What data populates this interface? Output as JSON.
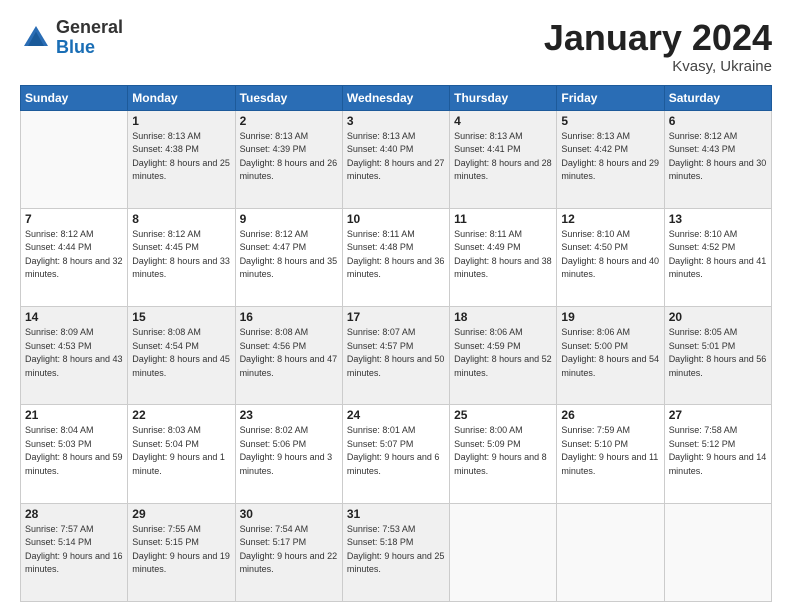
{
  "logo": {
    "general": "General",
    "blue": "Blue"
  },
  "header": {
    "month": "January 2024",
    "location": "Kvasy, Ukraine"
  },
  "days_of_week": [
    "Sunday",
    "Monday",
    "Tuesday",
    "Wednesday",
    "Thursday",
    "Friday",
    "Saturday"
  ],
  "weeks": [
    [
      {
        "day": "",
        "sunrise": "",
        "sunset": "",
        "daylight": ""
      },
      {
        "day": "1",
        "sunrise": "Sunrise: 8:13 AM",
        "sunset": "Sunset: 4:38 PM",
        "daylight": "Daylight: 8 hours and 25 minutes."
      },
      {
        "day": "2",
        "sunrise": "Sunrise: 8:13 AM",
        "sunset": "Sunset: 4:39 PM",
        "daylight": "Daylight: 8 hours and 26 minutes."
      },
      {
        "day": "3",
        "sunrise": "Sunrise: 8:13 AM",
        "sunset": "Sunset: 4:40 PM",
        "daylight": "Daylight: 8 hours and 27 minutes."
      },
      {
        "day": "4",
        "sunrise": "Sunrise: 8:13 AM",
        "sunset": "Sunset: 4:41 PM",
        "daylight": "Daylight: 8 hours and 28 minutes."
      },
      {
        "day": "5",
        "sunrise": "Sunrise: 8:13 AM",
        "sunset": "Sunset: 4:42 PM",
        "daylight": "Daylight: 8 hours and 29 minutes."
      },
      {
        "day": "6",
        "sunrise": "Sunrise: 8:12 AM",
        "sunset": "Sunset: 4:43 PM",
        "daylight": "Daylight: 8 hours and 30 minutes."
      }
    ],
    [
      {
        "day": "7",
        "sunrise": "Sunrise: 8:12 AM",
        "sunset": "Sunset: 4:44 PM",
        "daylight": "Daylight: 8 hours and 32 minutes."
      },
      {
        "day": "8",
        "sunrise": "Sunrise: 8:12 AM",
        "sunset": "Sunset: 4:45 PM",
        "daylight": "Daylight: 8 hours and 33 minutes."
      },
      {
        "day": "9",
        "sunrise": "Sunrise: 8:12 AM",
        "sunset": "Sunset: 4:47 PM",
        "daylight": "Daylight: 8 hours and 35 minutes."
      },
      {
        "day": "10",
        "sunrise": "Sunrise: 8:11 AM",
        "sunset": "Sunset: 4:48 PM",
        "daylight": "Daylight: 8 hours and 36 minutes."
      },
      {
        "day": "11",
        "sunrise": "Sunrise: 8:11 AM",
        "sunset": "Sunset: 4:49 PM",
        "daylight": "Daylight: 8 hours and 38 minutes."
      },
      {
        "day": "12",
        "sunrise": "Sunrise: 8:10 AM",
        "sunset": "Sunset: 4:50 PM",
        "daylight": "Daylight: 8 hours and 40 minutes."
      },
      {
        "day": "13",
        "sunrise": "Sunrise: 8:10 AM",
        "sunset": "Sunset: 4:52 PM",
        "daylight": "Daylight: 8 hours and 41 minutes."
      }
    ],
    [
      {
        "day": "14",
        "sunrise": "Sunrise: 8:09 AM",
        "sunset": "Sunset: 4:53 PM",
        "daylight": "Daylight: 8 hours and 43 minutes."
      },
      {
        "day": "15",
        "sunrise": "Sunrise: 8:08 AM",
        "sunset": "Sunset: 4:54 PM",
        "daylight": "Daylight: 8 hours and 45 minutes."
      },
      {
        "day": "16",
        "sunrise": "Sunrise: 8:08 AM",
        "sunset": "Sunset: 4:56 PM",
        "daylight": "Daylight: 8 hours and 47 minutes."
      },
      {
        "day": "17",
        "sunrise": "Sunrise: 8:07 AM",
        "sunset": "Sunset: 4:57 PM",
        "daylight": "Daylight: 8 hours and 50 minutes."
      },
      {
        "day": "18",
        "sunrise": "Sunrise: 8:06 AM",
        "sunset": "Sunset: 4:59 PM",
        "daylight": "Daylight: 8 hours and 52 minutes."
      },
      {
        "day": "19",
        "sunrise": "Sunrise: 8:06 AM",
        "sunset": "Sunset: 5:00 PM",
        "daylight": "Daylight: 8 hours and 54 minutes."
      },
      {
        "day": "20",
        "sunrise": "Sunrise: 8:05 AM",
        "sunset": "Sunset: 5:01 PM",
        "daylight": "Daylight: 8 hours and 56 minutes."
      }
    ],
    [
      {
        "day": "21",
        "sunrise": "Sunrise: 8:04 AM",
        "sunset": "Sunset: 5:03 PM",
        "daylight": "Daylight: 8 hours and 59 minutes."
      },
      {
        "day": "22",
        "sunrise": "Sunrise: 8:03 AM",
        "sunset": "Sunset: 5:04 PM",
        "daylight": "Daylight: 9 hours and 1 minute."
      },
      {
        "day": "23",
        "sunrise": "Sunrise: 8:02 AM",
        "sunset": "Sunset: 5:06 PM",
        "daylight": "Daylight: 9 hours and 3 minutes."
      },
      {
        "day": "24",
        "sunrise": "Sunrise: 8:01 AM",
        "sunset": "Sunset: 5:07 PM",
        "daylight": "Daylight: 9 hours and 6 minutes."
      },
      {
        "day": "25",
        "sunrise": "Sunrise: 8:00 AM",
        "sunset": "Sunset: 5:09 PM",
        "daylight": "Daylight: 9 hours and 8 minutes."
      },
      {
        "day": "26",
        "sunrise": "Sunrise: 7:59 AM",
        "sunset": "Sunset: 5:10 PM",
        "daylight": "Daylight: 9 hours and 11 minutes."
      },
      {
        "day": "27",
        "sunrise": "Sunrise: 7:58 AM",
        "sunset": "Sunset: 5:12 PM",
        "daylight": "Daylight: 9 hours and 14 minutes."
      }
    ],
    [
      {
        "day": "28",
        "sunrise": "Sunrise: 7:57 AM",
        "sunset": "Sunset: 5:14 PM",
        "daylight": "Daylight: 9 hours and 16 minutes."
      },
      {
        "day": "29",
        "sunrise": "Sunrise: 7:55 AM",
        "sunset": "Sunset: 5:15 PM",
        "daylight": "Daylight: 9 hours and 19 minutes."
      },
      {
        "day": "30",
        "sunrise": "Sunrise: 7:54 AM",
        "sunset": "Sunset: 5:17 PM",
        "daylight": "Daylight: 9 hours and 22 minutes."
      },
      {
        "day": "31",
        "sunrise": "Sunrise: 7:53 AM",
        "sunset": "Sunset: 5:18 PM",
        "daylight": "Daylight: 9 hours and 25 minutes."
      },
      {
        "day": "",
        "sunrise": "",
        "sunset": "",
        "daylight": ""
      },
      {
        "day": "",
        "sunrise": "",
        "sunset": "",
        "daylight": ""
      },
      {
        "day": "",
        "sunrise": "",
        "sunset": "",
        "daylight": ""
      }
    ]
  ]
}
